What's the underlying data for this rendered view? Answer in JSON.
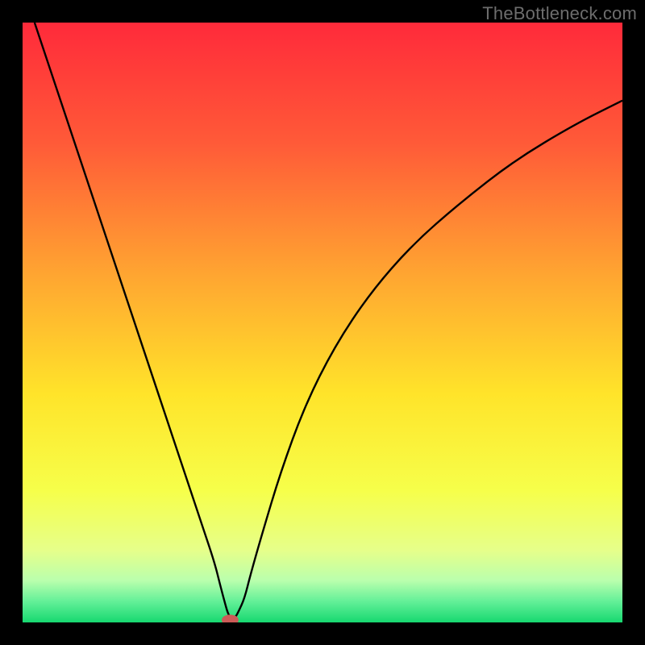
{
  "watermark": "TheBottleneck.com",
  "chart_data": {
    "type": "line",
    "title": "",
    "xlabel": "",
    "ylabel": "",
    "xlim": [
      0,
      100
    ],
    "ylim": [
      0,
      100
    ],
    "background_gradient": {
      "stops": [
        {
          "offset": 0.0,
          "color": "#ff2a3a"
        },
        {
          "offset": 0.2,
          "color": "#ff5a38"
        },
        {
          "offset": 0.42,
          "color": "#ffa531"
        },
        {
          "offset": 0.62,
          "color": "#ffe42a"
        },
        {
          "offset": 0.78,
          "color": "#f6ff4a"
        },
        {
          "offset": 0.88,
          "color": "#e6ff8a"
        },
        {
          "offset": 0.93,
          "color": "#baffad"
        },
        {
          "offset": 0.965,
          "color": "#63f098"
        },
        {
          "offset": 1.0,
          "color": "#17d870"
        }
      ]
    },
    "series": [
      {
        "name": "bottleneck-curve",
        "color": "#000000",
        "x": [
          2,
          5,
          10,
          15,
          20,
          25,
          28,
          30,
          32,
          33,
          33.8,
          34.2,
          34.6,
          35,
          35.5,
          36,
          37,
          38,
          40,
          43,
          47,
          52,
          58,
          65,
          73,
          82,
          92,
          100
        ],
        "y": [
          100,
          91,
          76,
          61,
          46,
          31,
          22,
          16,
          10,
          6,
          3,
          1.6,
          0.9,
          0.5,
          0.9,
          1.8,
          4,
          8,
          15,
          25,
          36,
          46,
          55,
          63,
          70,
          77,
          83,
          87
        ]
      }
    ],
    "marker": {
      "x": 34.6,
      "y": 0.4,
      "rx": 1.4,
      "ry": 0.9,
      "color": "#cc5b57"
    }
  }
}
